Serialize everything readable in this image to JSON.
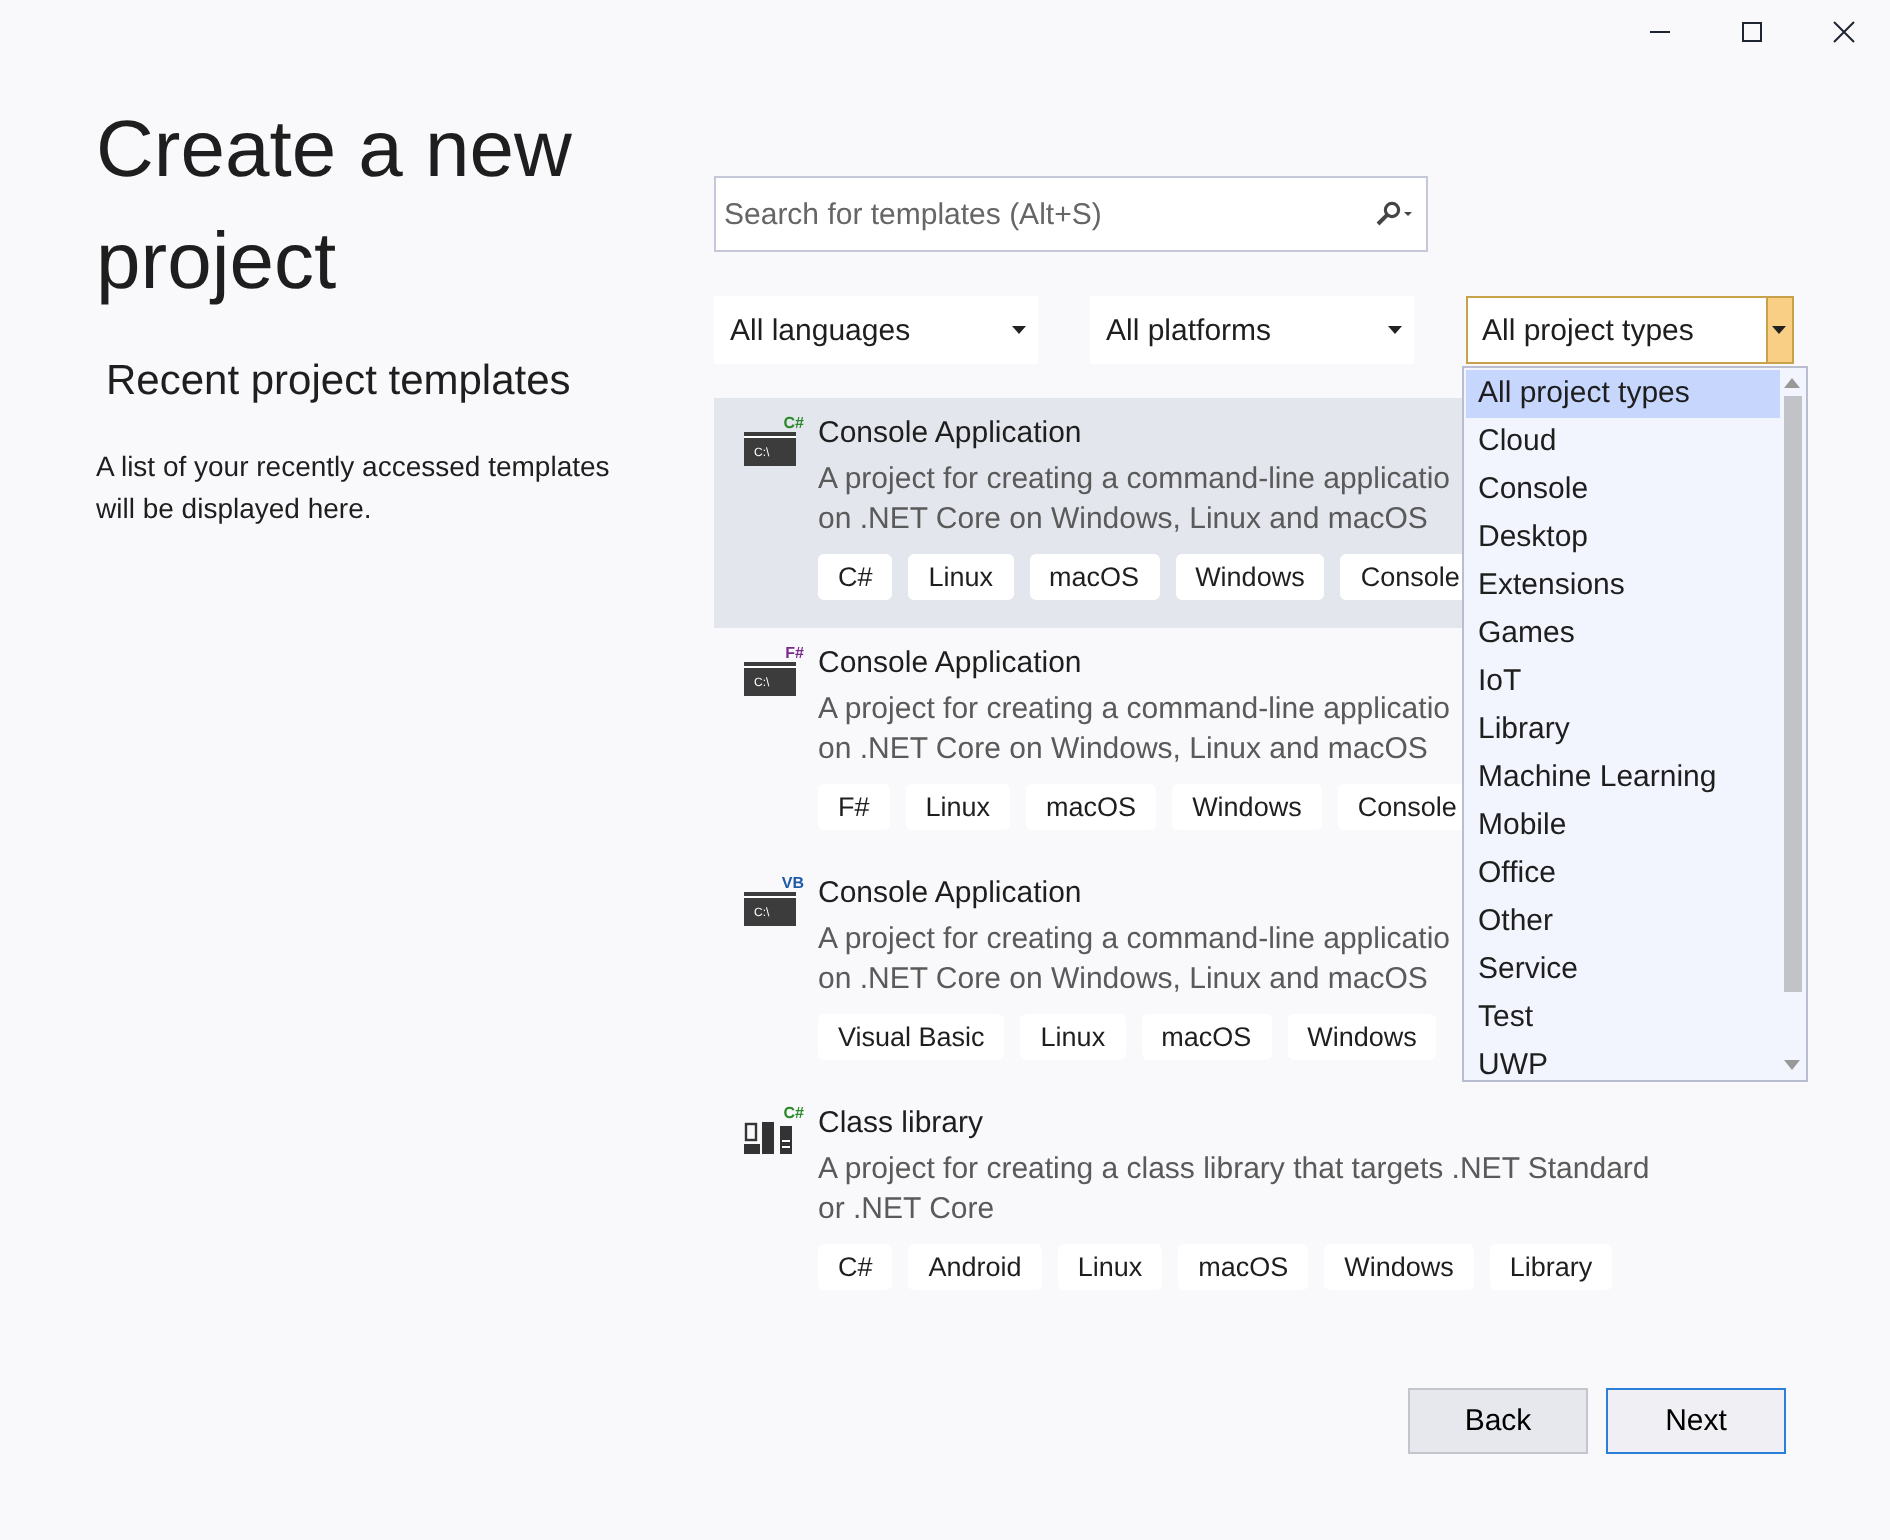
{
  "title": "Create a new project",
  "recent": {
    "heading": "Recent project templates",
    "text": "A list of your recently accessed templates will be displayed here."
  },
  "search": {
    "placeholder": "Search for templates (Alt+S)"
  },
  "filters": [
    {
      "value": "All languages",
      "open": false
    },
    {
      "value": "All platforms",
      "open": false
    },
    {
      "value": "All project types",
      "open": true
    }
  ],
  "dropdown": {
    "options": [
      {
        "label": "All project types",
        "selected": true
      },
      {
        "label": "Cloud",
        "selected": false
      },
      {
        "label": "Console",
        "selected": false
      },
      {
        "label": "Desktop",
        "selected": false
      },
      {
        "label": "Extensions",
        "selected": false
      },
      {
        "label": "Games",
        "selected": false
      },
      {
        "label": "IoT",
        "selected": false
      },
      {
        "label": "Library",
        "selected": false
      },
      {
        "label": "Machine Learning",
        "selected": false
      },
      {
        "label": "Mobile",
        "selected": false
      },
      {
        "label": "Office",
        "selected": false
      },
      {
        "label": "Other",
        "selected": false
      },
      {
        "label": "Service",
        "selected": false
      },
      {
        "label": "Test",
        "selected": false
      },
      {
        "label": "UWP",
        "selected": false
      }
    ]
  },
  "templates": [
    {
      "name": "Console Application",
      "kind": "console",
      "badge": "C#",
      "color": "#2c8a2c",
      "prompt": "C:\\",
      "selected": true,
      "description": [
        "A project for creating a command-line applicatio",
        "on .NET Core on Windows, Linux and macOS"
      ],
      "tags": [
        "C#",
        "Linux",
        "macOS",
        "Windows",
        "Console"
      ]
    },
    {
      "name": "Console Application",
      "kind": "console",
      "badge": "F#",
      "color": "#7a2a8c",
      "prompt": "C:\\",
      "selected": false,
      "description": [
        "A project for creating a command-line applicatio",
        "on .NET Core on Windows, Linux and macOS"
      ],
      "tags": [
        "F#",
        "Linux",
        "macOS",
        "Windows",
        "Console"
      ]
    },
    {
      "name": "Console Application",
      "kind": "console",
      "badge": "VB",
      "color": "#1e5aa8",
      "prompt": "C:\\",
      "selected": false,
      "description": [
        "A project for creating a command-line applicatio",
        "on .NET Core on Windows, Linux and macOS"
      ],
      "tags": [
        "Visual Basic",
        "Linux",
        "macOS",
        "Windows"
      ]
    },
    {
      "name": "Class library",
      "kind": "library",
      "badge": "C#",
      "color": "#2c8a2c",
      "selected": false,
      "description": [
        "A project for creating a class library that targets .NET Standard",
        "or .NET Core"
      ],
      "tags": [
        "C#",
        "Android",
        "Linux",
        "macOS",
        "Windows",
        "Library"
      ]
    }
  ],
  "buttons": [
    {
      "label": "Back",
      "primary": false
    },
    {
      "label": "Next",
      "primary": true
    }
  ]
}
